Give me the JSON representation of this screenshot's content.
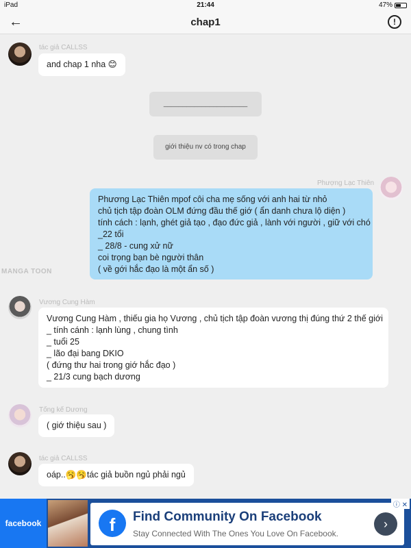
{
  "status_bar": {
    "device": "iPad",
    "time": "21:44",
    "battery": "47%",
    "battery_level": 0.47
  },
  "header": {
    "title": "chap1"
  },
  "watermark": "MANGA TOON",
  "messages": [
    {
      "author": "tác giả CALLSS",
      "lines": [
        "and chap 1 nha 😊"
      ]
    },
    {
      "system": "______________________"
    },
    {
      "system": "giới thiệu nv có trong chap"
    },
    {
      "author": "Phượng Lạc Thiên",
      "lines": [
        "Phương Lạc Thiên mpof côi cha mẹ sống với anh hai từ nhỏ",
        "chủ tịch tập đoàn OLM đứng đầu thế giớ ( ẩn danh chưa lộ diện )",
        "tính cách : lạnh, ghét giả tạo , đạo đức giả , lành với người , giữ với chó",
        "_22 tổi",
        "_ 28/8 - cung xử nữ",
        "coi trọng bạn bè người thân",
        "( về gới hắc đạo là một ẩn số )"
      ]
    },
    {
      "author": "Vương Cung Hàm",
      "lines": [
        "Vương Cung Hàm , thiếu gia họ Vương , chủ tịch tập đoàn vương thị đúng thứ 2 thế giới",
        "_ tính cánh : lạnh lùng , chung tình",
        "_ tuổi 25",
        "_ lão đại bang DKIO",
        "( đứng thư hai trong giớ  hắc đạo )",
        "_ 21/3 cung bạch dương"
      ]
    },
    {
      "author": "Tống kế Dương",
      "lines": [
        "( giớ thiệu sau )"
      ]
    },
    {
      "author": "tác giả CALLSS",
      "lines": [
        "oáp..🥱🥱tác giả buồn ngủ phải ngủ"
      ]
    }
  ],
  "ad": {
    "brand_tag": "facebook",
    "title": "Find Community On Facebook",
    "subtitle": "Stay Connected With The Ones You Love On Facebook."
  }
}
